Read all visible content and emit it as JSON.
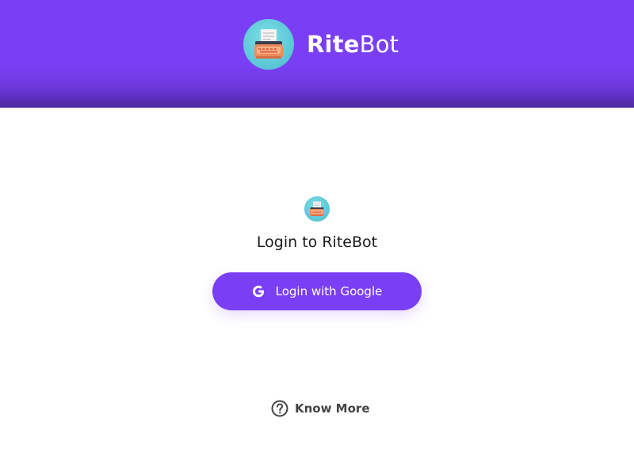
{
  "header": {
    "brand_strong": "Rite",
    "brand_light": "Bot",
    "logo_icon": "typewriter-icon"
  },
  "login": {
    "title": "Login to RiteBot",
    "google_button_label": "Login with Google",
    "google_icon": "google-icon"
  },
  "footer": {
    "know_more_label": "Know More",
    "help_icon": "question-circle-icon"
  },
  "colors": {
    "brand_purple": "#7a3ff5",
    "logo_teal": "#5fc9d8",
    "typewriter_orange": "#f08a5d"
  }
}
